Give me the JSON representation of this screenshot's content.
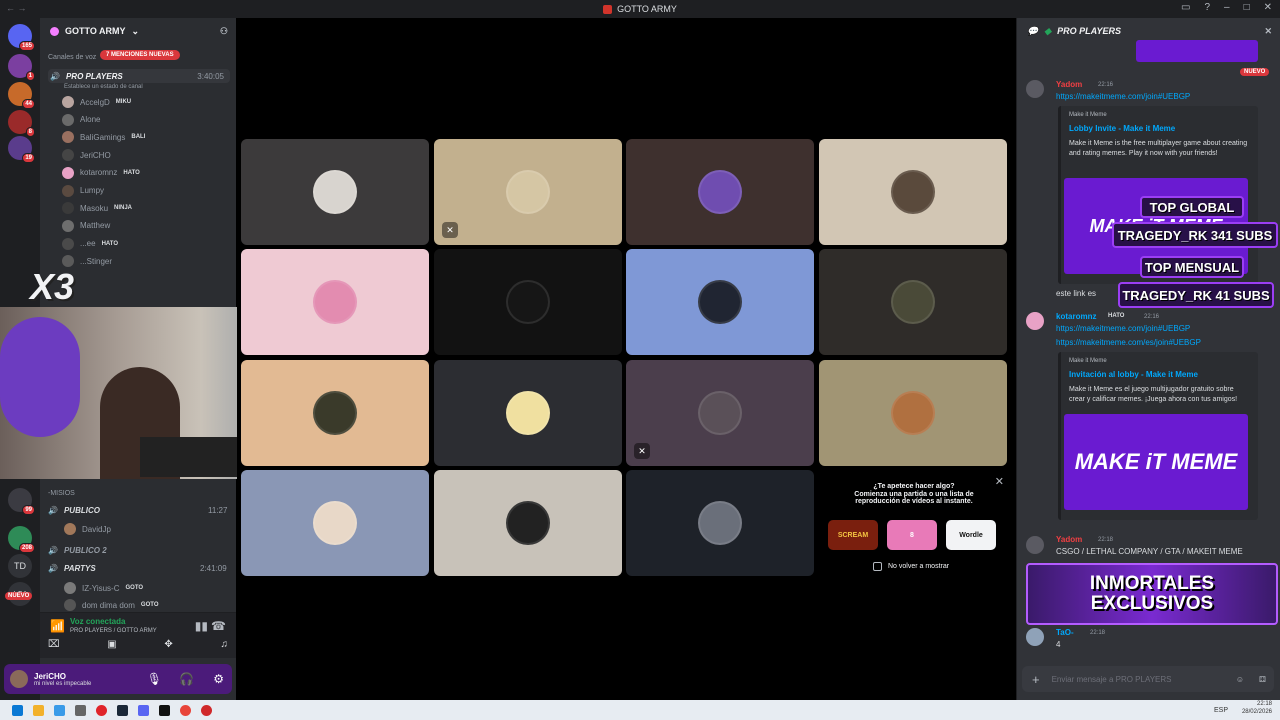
{
  "window": {
    "title": "GOTTO ARMY",
    "nav": "← →"
  },
  "rail": {
    "badges": [
      "165",
      "1",
      "44",
      "8",
      "19",
      "99",
      "208",
      "TD",
      "LC4"
    ],
    "new_badge": "NUEVO"
  },
  "server": {
    "name": "GOTTO ARMY",
    "voice_label": "Canales de voz",
    "mentions": "7 MENCIONES NUEVAS"
  },
  "channels": {
    "active": {
      "name": "PRO PLAYERS",
      "timer": "3:40:05",
      "status": "Establece un estado de canal"
    },
    "members": [
      {
        "name": "AccelgD",
        "tag": "MIKU"
      },
      {
        "name": "Alone",
        "tag": ""
      },
      {
        "name": "BaliGamings",
        "tag": "BALI"
      },
      {
        "name": "JeriCHO",
        "tag": ""
      },
      {
        "name": "kotaromnz",
        "tag": "HATO"
      },
      {
        "name": "Lumpy",
        "tag": ""
      },
      {
        "name": "Masoku",
        "tag": "NINJA"
      },
      {
        "name": "Matthew",
        "tag": ""
      },
      {
        "name": "...ee",
        "tag": "HATO"
      },
      {
        "name": "...Stinger",
        "tag": ""
      }
    ],
    "category": "-MISIOS",
    "publico": {
      "name": "PUBLICO",
      "timer": "11:27",
      "member": "DavidJp"
    },
    "publico2": {
      "name": "PUBLICO 2"
    },
    "partys": {
      "name": "PARTYS",
      "timer": "2:41:09",
      "members": [
        {
          "name": "IZ-Yisus-C",
          "tag": "GOTO"
        },
        {
          "name": "dom dima dom",
          "tag": "GOTO"
        }
      ]
    }
  },
  "voice": {
    "status": "Voz conectada",
    "location": "PRO PLAYERS / GOTTO ARMY"
  },
  "user": {
    "name": "JeriCHO",
    "status": "mi nivel es impecable"
  },
  "overlay": {
    "text": "X3"
  },
  "activity": {
    "title": "¿Te apetece hacer algo?",
    "desc": "Comienza una partida o una lista de reproducción de vídeos al instante.",
    "games": [
      "SCREAM",
      "8",
      "Wordle"
    ],
    "checkbox": "No volver a mostrar"
  },
  "chat": {
    "channel": "PRO PLAYERS",
    "new_label": "NUEVO",
    "messages": [
      {
        "author": "Yadom",
        "time": "22:16",
        "text": "https://makeitmeme.com/join#UEBGP",
        "color": "#f23f43"
      },
      {
        "author": "",
        "time": "",
        "text": "este link es",
        "color": ""
      },
      {
        "author": "kotaromnz",
        "time": "22:16",
        "text": "https://makeitmeme.com/join#UEBGP",
        "text2": "https://makeitmeme.com/es/join#UEBGP",
        "tag": "HATO",
        "color": "#00a8fc"
      },
      {
        "author": "Yadom",
        "time": "22:18",
        "text": "CSGO / LETHAL COMPANY / GTA / MAKEIT MEME",
        "color": "#f23f43"
      },
      {
        "author": "TaO-",
        "time": "22:18",
        "text": "4",
        "color": "#00a8fc"
      }
    ],
    "embed1": {
      "provider": "Make it Meme",
      "title": "Lobby Invite - Make it Meme",
      "desc": "Make it Meme is the free multiplayer game about creating and rating memes. Play it now with your friends!"
    },
    "embed2": {
      "provider": "Make it Meme",
      "title": "Invitación al lobby - Make it Meme",
      "desc": "Make it Meme es el juego multijugador gratuito sobre crear y calificar memes. ¡Juega ahora con tus amigos!"
    },
    "promo_image": "MAKE iT MEME",
    "overlay_labels": [
      "TOP GLOBAL",
      "TRAGEDY_RK 341 SUBS",
      "TOP MENSUAL",
      "TRAGEDY_RK 41 SUBS"
    ],
    "banner": "INMORTALES EXCLUSIVOS",
    "input_placeholder": "Enviar mensaje a PRO PLAYERS"
  },
  "taskbar": {
    "lang": "ESP",
    "time": "22:18",
    "date": "28/02/2026"
  },
  "colors": {
    "accent": "#5865f2",
    "bg_dark": "#1e1f22",
    "purple": "#9b3ef5",
    "online": "#23a55a"
  }
}
